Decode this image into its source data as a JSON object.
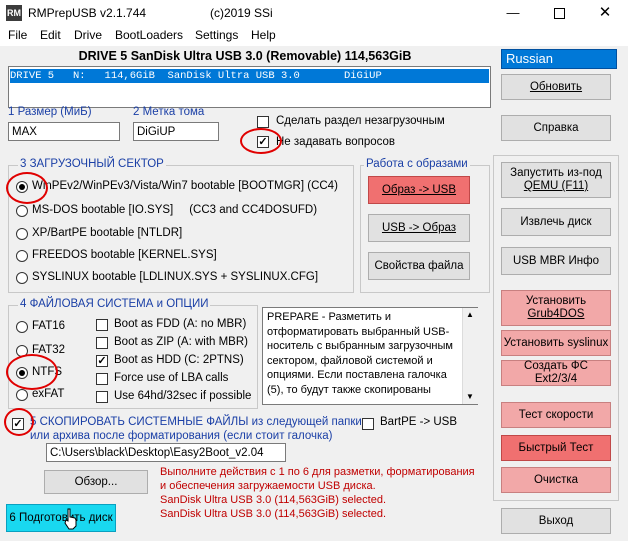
{
  "window": {
    "title": "RMPrepUSB v2.1.744",
    "copyright": "(c)2019 SSi",
    "icon_text": "RM",
    "controls": [
      "minimize-icon",
      "maximize-icon",
      "close-icon"
    ]
  },
  "menu": [
    "File",
    "Edit",
    "Drive",
    "BootLoaders",
    "Settings",
    "Help"
  ],
  "drive": {
    "title": "DRIVE 5 SanDisk Ultra USB 3.0  (Removable) 114,563GiB",
    "row": "DRIVE 5   N:   114,6GiB  SanDisk Ultra USB 3.0       DiGiUP"
  },
  "language": "Russian",
  "fields": {
    "size_label": "1 Размер (МиБ)",
    "size_value": "MAX",
    "volume_label": "2 Метка тома",
    "volume_value": "DiGiUP"
  },
  "options": {
    "nonboot_label": "Сделать раздел незагрузочным",
    "nonboot_checked": false,
    "noask_label": "Не задавать вопросов",
    "noask_checked": true
  },
  "boot_sector": {
    "title": "3 ЗАГРУЗОЧНЫЙ СЕКТОР",
    "items": [
      {
        "label": "WinPEv2/WinPEv3/Vista/Win7 bootable [BOOTMGR] (CC4)",
        "selected": true
      },
      {
        "label": "MS-DOS bootable [IO.SYS]     (CC3 and CC4DOSUFD)",
        "selected": false
      },
      {
        "label": "XP/BartPE bootable [NTLDR]",
        "selected": false
      },
      {
        "label": "FREEDOS bootable [KERNEL.SYS]",
        "selected": false
      },
      {
        "label": "SYSLINUX bootable [LDLINUX.SYS + SYSLINUX.CFG]",
        "selected": false
      }
    ]
  },
  "images": {
    "title": "Работа с образами",
    "img_to_usb": "Образ -> USB",
    "usb_to_img": "USB -> Образ",
    "file_props": "Свойства файла"
  },
  "filesystem": {
    "title": "4 ФАЙЛОВАЯ СИСТЕМА и ОПЦИИ",
    "types": [
      {
        "label": "FAT16",
        "selected": false
      },
      {
        "label": "FAT32",
        "selected": false
      },
      {
        "label": "NTFS",
        "selected": true
      },
      {
        "label": "exFAT",
        "selected": false
      }
    ],
    "checks": [
      {
        "label": "Boot as FDD (A: no MBR)",
        "checked": false
      },
      {
        "label": "Boot as ZIP (A: with MBR)",
        "checked": false
      },
      {
        "label": "Boot as HDD (C: 2PTNS)",
        "checked": true
      },
      {
        "label": "Force use of LBA calls",
        "checked": false
      },
      {
        "label": "Use 64hd/32sec if possible",
        "checked": false
      }
    ]
  },
  "info_text": "PREPARE - Разметить и отформатировать выбранный USB-носитель с выбранным загрузочным сектором, файловой системой и опциями. Если поставлена галочка (5), то будут также скопированы",
  "copy": {
    "line1": "5 СКОПИРОВАТЬ СИСТЕМНЫЕ ФАЙЛЫ из следующей папки",
    "line2": "или архива после форматирования (если стоит галочка)",
    "checked": true,
    "bartpe_label": "BartPE -> USB",
    "bartpe_checked": false,
    "path": "C:\\Users\\black\\Desktop\\Easy2Boot_v2.04"
  },
  "browse": "Обзор...",
  "status": [
    "Выполните действия с 1 по 6 для разметки, форматирования",
    "и обеспечения загружаемости USB диска.",
    "SanDisk Ultra USB 3.0 (114,563GiB) selected.",
    "SanDisk Ultra USB 3.0 (114,563GiB) selected."
  ],
  "prepare_button": "6 Подготовить диск",
  "right_buttons": {
    "refresh": "Обновить",
    "help": "Справка",
    "qemu_line1": "Запустить из-под",
    "qemu_line2": "QEMU (F11)",
    "eject": "Извлечь диск",
    "mbr_info": "USB MBR Инфо",
    "grub_line1": "Установить",
    "grub_line2": "Grub4DOS",
    "syslinux": "Установить syslinux",
    "ext": "Создать ФС Ext2/3/4",
    "speed": "Тест скорости",
    "quick": "Быстрый Тест",
    "clean": "Очистка",
    "exit": "Выход"
  },
  "colors": {
    "selection": "#0078d7",
    "annotation": "#e00000",
    "status_text": "#c00000",
    "prepare_button": "#19d8f0"
  }
}
